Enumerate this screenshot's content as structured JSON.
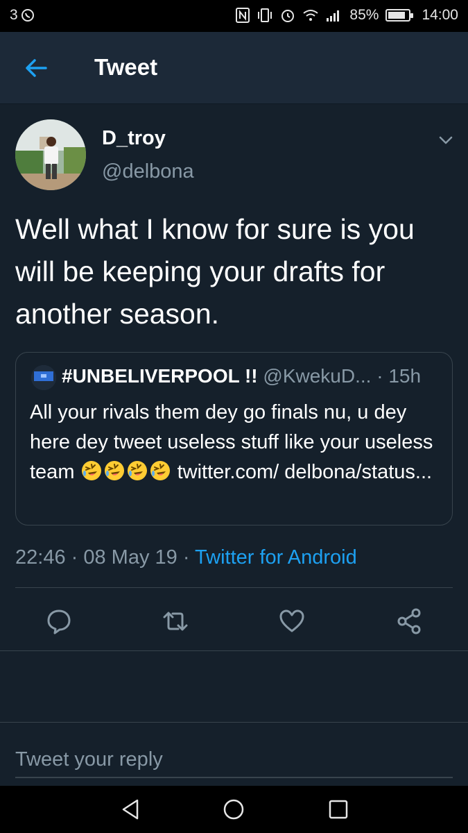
{
  "status_bar": {
    "notification_count": "3",
    "battery": "85%",
    "battery_level": 0.85,
    "time": "14:00",
    "icons": [
      "whatsapp-icon",
      "nfc-icon",
      "vibrate-icon",
      "alarm-icon",
      "wifi-icon",
      "signal-icon",
      "battery-icon"
    ]
  },
  "app_bar": {
    "title": "Tweet",
    "back_icon": "back-arrow-icon"
  },
  "tweet": {
    "author_name": "D_troy",
    "author_handle": "@delbona",
    "text": "Well what I know for sure is you will be keeping your drafts for another season.",
    "quoted": {
      "name": "#UNBELIVERPOOL !!",
      "handle": "@KwekuD...",
      "separator": " · ",
      "age": "15h",
      "text_part1": "All your rivals them dey go finals nu, u dey here dey tweet useless stuff like your useless team ",
      "emoji_name": "rolling-on-floor-laughing-emoji",
      "emoji_count": 4,
      "text_part2": " twitter.com/ delbona/status..."
    },
    "time": "22:46",
    "dot1": " · ",
    "date": "08 May 19",
    "dot2": " · ",
    "source": "Twitter for Android"
  },
  "actions": [
    "reply-icon",
    "retweet-icon",
    "like-icon",
    "share-icon"
  ],
  "reply_box": {
    "placeholder": "Tweet your reply"
  },
  "nav_bar": [
    "back-triangle-icon",
    "home-circle-icon",
    "recents-square-icon"
  ],
  "colors": {
    "background": "#15202b",
    "app_bar": "#1c2938",
    "accent": "#1da1f2",
    "secondary_text": "#8899a6",
    "border": "#38444d"
  }
}
